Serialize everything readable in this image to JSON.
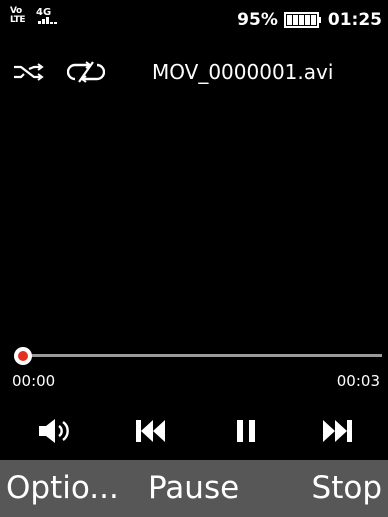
{
  "status_bar": {
    "volte_label": "Vo LTE",
    "network_label": "4G",
    "battery_percent": "95%",
    "battery_level": 0.95,
    "time": "01:25"
  },
  "player": {
    "file_name": "MOV_0000001.avi",
    "shuffle_icon": "shuffle-off-icon",
    "repeat_icon": "repeat-off-icon",
    "current_time": "00:00",
    "total_time": "00:03",
    "progress_fraction": 0.0,
    "accent_color": "#d32b1f"
  },
  "controls": {
    "volume_icon": "volume-icon",
    "previous_icon": "previous-icon",
    "pause_icon": "pause-icon",
    "next_icon": "next-icon"
  },
  "softkeys": {
    "left": "Optio...",
    "center": "Pause",
    "right": "Stop"
  }
}
